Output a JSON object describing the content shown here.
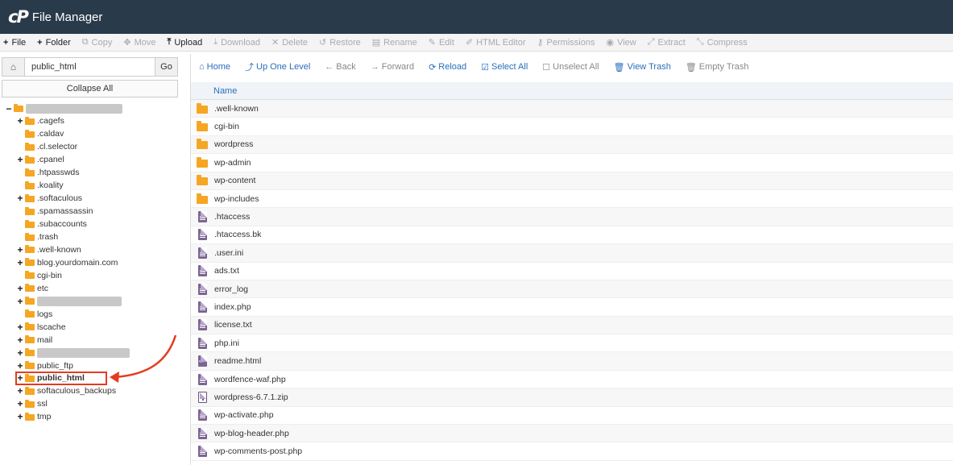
{
  "header": {
    "logo": "cP",
    "title": "File Manager"
  },
  "toolbar": [
    {
      "icon": "plus-icon",
      "glyph": "+",
      "label": "File",
      "enabled": true,
      "bold_icon": true
    },
    {
      "icon": "plus-icon",
      "glyph": "+",
      "label": "Folder",
      "enabled": true,
      "bold_icon": true
    },
    {
      "icon": "copy-icon",
      "glyph": "⧉",
      "label": "Copy",
      "enabled": false
    },
    {
      "icon": "move-icon",
      "glyph": "✥",
      "label": "Move",
      "enabled": false
    },
    {
      "icon": "upload-icon",
      "glyph": "⤒",
      "label": "Upload",
      "enabled": true,
      "bold_icon": true
    },
    {
      "icon": "download-icon",
      "glyph": "⤓",
      "label": "Download",
      "enabled": false
    },
    {
      "icon": "delete-icon",
      "glyph": "✕",
      "label": "Delete",
      "enabled": false
    },
    {
      "icon": "restore-icon",
      "glyph": "↺",
      "label": "Restore",
      "enabled": false
    },
    {
      "icon": "rename-icon",
      "glyph": "▤",
      "label": "Rename",
      "enabled": false
    },
    {
      "icon": "edit-icon",
      "glyph": "✎",
      "label": "Edit",
      "enabled": false
    },
    {
      "icon": "html-editor-icon",
      "glyph": "✐",
      "label": "HTML Editor",
      "enabled": false
    },
    {
      "icon": "permissions-icon",
      "glyph": "⚷",
      "label": "Permissions",
      "enabled": false
    },
    {
      "icon": "view-icon",
      "glyph": "◉",
      "label": "View",
      "enabled": false
    },
    {
      "icon": "extract-icon",
      "glyph": "⤢",
      "label": "Extract",
      "enabled": false
    },
    {
      "icon": "compress-icon",
      "glyph": "⤡",
      "label": "Compress",
      "enabled": false
    }
  ],
  "left": {
    "path_value": "public_html",
    "go_label": "Go",
    "collapse_label": "Collapse All"
  },
  "tree": [
    {
      "toggle": "−",
      "label": "",
      "blurred": true,
      "blur_width": 120,
      "depth": 0
    },
    {
      "toggle": "+",
      "label": ".cagefs",
      "depth": 1
    },
    {
      "toggle": "",
      "label": ".caldav",
      "depth": 1
    },
    {
      "toggle": "",
      "label": ".cl.selector",
      "depth": 1
    },
    {
      "toggle": "+",
      "label": ".cpanel",
      "depth": 1
    },
    {
      "toggle": "",
      "label": ".htpasswds",
      "depth": 1
    },
    {
      "toggle": "",
      "label": ".koality",
      "depth": 1
    },
    {
      "toggle": "+",
      "label": ".softaculous",
      "depth": 1
    },
    {
      "toggle": "",
      "label": ".spamassassin",
      "depth": 1
    },
    {
      "toggle": "",
      "label": ".subaccounts",
      "depth": 1
    },
    {
      "toggle": "",
      "label": ".trash",
      "depth": 1
    },
    {
      "toggle": "+",
      "label": ".well-known",
      "depth": 1
    },
    {
      "toggle": "+",
      "label": "blog.yourdomain.com",
      "depth": 1
    },
    {
      "toggle": "",
      "label": "cgi-bin",
      "depth": 1
    },
    {
      "toggle": "+",
      "label": "etc",
      "depth": 1
    },
    {
      "toggle": "+",
      "label": "",
      "blurred": true,
      "blur_width": 105,
      "depth": 1
    },
    {
      "toggle": "",
      "label": "logs",
      "depth": 1
    },
    {
      "toggle": "+",
      "label": "lscache",
      "depth": 1
    },
    {
      "toggle": "+",
      "label": "mail",
      "depth": 1
    },
    {
      "toggle": "+",
      "label": "",
      "blurred": true,
      "blur_width": 115,
      "depth": 1
    },
    {
      "toggle": "+",
      "label": "public_ftp",
      "depth": 1
    },
    {
      "toggle": "+",
      "label": "public_html",
      "depth": 1,
      "selected": true
    },
    {
      "toggle": "+",
      "label": "softaculous_backups",
      "depth": 1
    },
    {
      "toggle": "+",
      "label": "ssl",
      "depth": 1
    },
    {
      "toggle": "+",
      "label": "tmp",
      "depth": 1
    }
  ],
  "navbar": [
    {
      "icon": "home-icon",
      "glyph": "⌂",
      "label": "Home",
      "enabled": true
    },
    {
      "icon": "up-level-icon",
      "glyph": "⤴",
      "label": "Up One Level",
      "enabled": true
    },
    {
      "icon": "back-icon",
      "glyph": "←",
      "label": "Back",
      "enabled": false
    },
    {
      "icon": "forward-icon",
      "glyph": "→",
      "label": "Forward",
      "enabled": false
    },
    {
      "icon": "reload-icon",
      "glyph": "⟳",
      "label": "Reload",
      "enabled": true
    },
    {
      "icon": "select-all-icon",
      "glyph": "☑",
      "label": "Select All",
      "enabled": true
    },
    {
      "icon": "unselect-all-icon",
      "glyph": "☐",
      "label": "Unselect All",
      "enabled": false
    },
    {
      "icon": "trash-icon",
      "glyph": "🗑",
      "label": "View Trash",
      "enabled": true
    },
    {
      "icon": "empty-trash-icon",
      "glyph": "🗑",
      "label": "Empty Trash",
      "enabled": false
    }
  ],
  "table": {
    "header_name": "Name",
    "rows": [
      {
        "name": ".well-known",
        "type": "folder"
      },
      {
        "name": "cgi-bin",
        "type": "folder"
      },
      {
        "name": "wordpress",
        "type": "folder"
      },
      {
        "name": "wp-admin",
        "type": "folder"
      },
      {
        "name": "wp-content",
        "type": "folder"
      },
      {
        "name": "wp-includes",
        "type": "folder"
      },
      {
        "name": ".htaccess",
        "type": "file"
      },
      {
        "name": ".htaccess.bk",
        "type": "file"
      },
      {
        "name": ".user.ini",
        "type": "file"
      },
      {
        "name": "ads.txt",
        "type": "file"
      },
      {
        "name": "error_log",
        "type": "file"
      },
      {
        "name": "index.php",
        "type": "file"
      },
      {
        "name": "license.txt",
        "type": "file"
      },
      {
        "name": "php.ini",
        "type": "file"
      },
      {
        "name": "readme.html",
        "type": "html"
      },
      {
        "name": "wordfence-waf.php",
        "type": "file"
      },
      {
        "name": "wordpress-6.7.1.zip",
        "type": "zip"
      },
      {
        "name": "wp-activate.php",
        "type": "file"
      },
      {
        "name": "wp-blog-header.php",
        "type": "file"
      },
      {
        "name": "wp-comments-post.php",
        "type": "file"
      }
    ]
  },
  "colors": {
    "header_bg": "#293a4a",
    "link": "#2a6ebb",
    "folder": "#f5a623",
    "file": "#7a6591",
    "annotation": "#e53b1f"
  }
}
